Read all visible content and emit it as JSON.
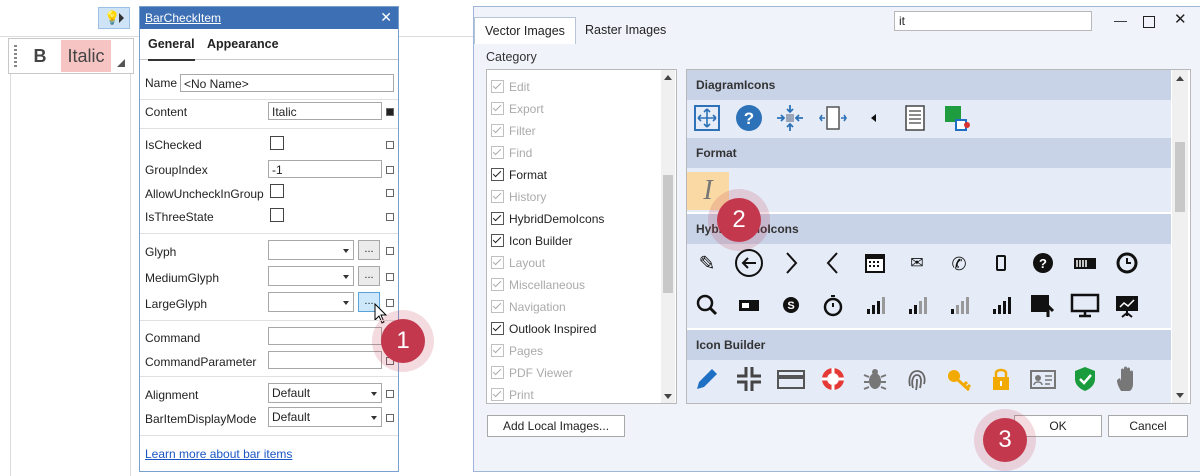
{
  "toolbar": {
    "bold_label": "B",
    "italic_label": "Italic"
  },
  "panel": {
    "title": "BarCheckItem",
    "close": "✕",
    "tabs": [
      "General",
      "Appearance"
    ],
    "name_label": "Name",
    "name_value": "<No Name>",
    "content_label": "Content",
    "content_value": "Italic",
    "ischecked_label": "IsChecked",
    "groupindex_label": "GroupIndex",
    "groupindex_value": "-1",
    "allowuncheck_label": "AllowUncheckInGroup",
    "isthreestate_label": "IsThreeState",
    "glyph_label": "Glyph",
    "mediumglyph_label": "MediumGlyph",
    "largeglyph_label": "LargeGlyph",
    "ellipsis": "...",
    "command_label": "Command",
    "commandparam_label": "CommandParameter",
    "alignment_label": "Alignment",
    "alignment_value": "Default",
    "displaymode_label": "BarItemDisplayMode",
    "displaymode_value": "Default",
    "link": "Learn more about bar items"
  },
  "dialog": {
    "tabs": [
      "Vector Images",
      "Raster Images"
    ],
    "search_value": "it",
    "category_label": "Category",
    "categories": [
      {
        "label": "Edit",
        "checked": false
      },
      {
        "label": "Export",
        "checked": false
      },
      {
        "label": "Filter",
        "checked": false
      },
      {
        "label": "Find",
        "checked": false
      },
      {
        "label": "Format",
        "checked": true
      },
      {
        "label": "History",
        "checked": false
      },
      {
        "label": "HybridDemoIcons",
        "checked": true
      },
      {
        "label": "Icon Builder",
        "checked": true
      },
      {
        "label": "Layout",
        "checked": false
      },
      {
        "label": "Miscellaneous",
        "checked": false
      },
      {
        "label": "Navigation",
        "checked": false
      },
      {
        "label": "Outlook Inspired",
        "checked": true
      },
      {
        "label": "Pages",
        "checked": false
      },
      {
        "label": "PDF Viewer",
        "checked": false
      },
      {
        "label": "Print",
        "checked": false
      }
    ],
    "groups": {
      "diagram": "DiagramIcons",
      "format": "Format",
      "hybrid": "HybridDemoIcons",
      "builder": "Icon Builder"
    },
    "add_local": "Add Local Images...",
    "ok": "OK",
    "cancel": "Cancel"
  },
  "badges": [
    "1",
    "2",
    "3"
  ],
  "colors": {
    "accent": "#3d6fb4",
    "badge": "#c3384d",
    "italic_highlight": "#f7c4c4",
    "selected_image": "#fbd9a4"
  }
}
